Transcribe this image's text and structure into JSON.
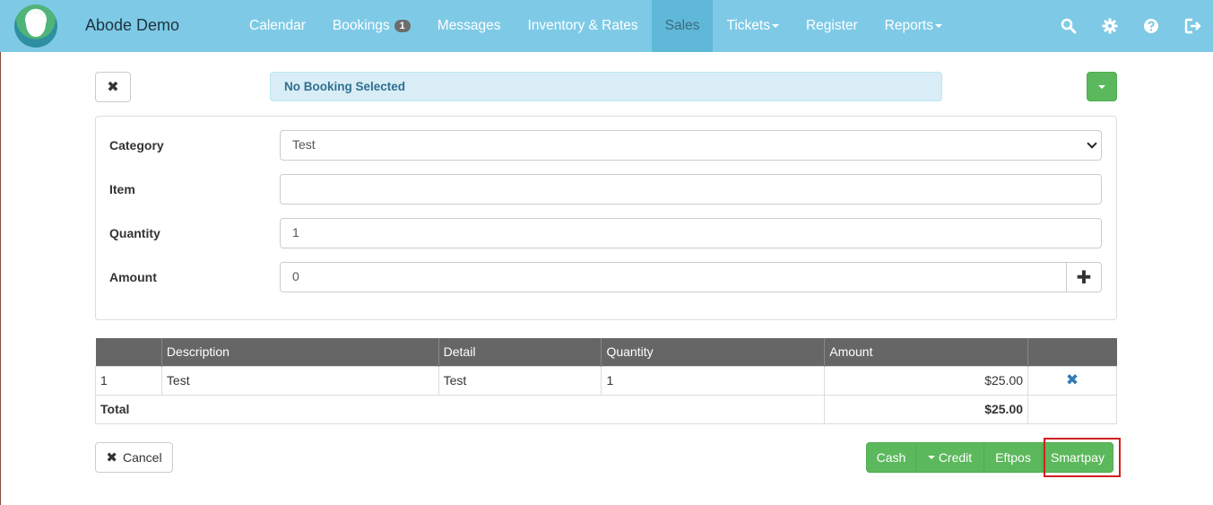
{
  "navbar": {
    "brand": "Abode Demo",
    "items": [
      {
        "label": "Calendar"
      },
      {
        "label": "Bookings",
        "badge": "1"
      },
      {
        "label": "Messages"
      },
      {
        "label": "Inventory & Rates"
      },
      {
        "label": "Sales",
        "active": true
      },
      {
        "label": "Tickets",
        "dropdown": true
      },
      {
        "label": "Register"
      },
      {
        "label": "Reports",
        "dropdown": true
      }
    ],
    "icons": [
      "search-icon",
      "gear-icon",
      "help-icon",
      "logout-icon"
    ],
    "color": "#7ecae6"
  },
  "booking_alert": "No Booking Selected",
  "form": {
    "category": {
      "label": "Category",
      "value": "Test"
    },
    "item": {
      "label": "Item",
      "value": ""
    },
    "quantity": {
      "label": "Quantity",
      "value": "1"
    },
    "amount": {
      "label": "Amount",
      "value": "0"
    }
  },
  "table": {
    "headers": [
      "",
      "Description",
      "Detail",
      "Quantity",
      "Amount",
      ""
    ],
    "rows": [
      {
        "index": "1",
        "description": "Test",
        "detail": "Test",
        "quantity": "1",
        "amount": "$25.00"
      }
    ],
    "total_label": "Total",
    "total_amount": "$25.00"
  },
  "buttons": {
    "cancel": "Cancel",
    "cash": "Cash",
    "credit": "Credit",
    "eftpos": "Eftpos",
    "smartpay": "Smartpay"
  },
  "colors": {
    "success": "#5cb85c",
    "highlight": "#d21f1f",
    "info_bg": "#d9edf7"
  }
}
